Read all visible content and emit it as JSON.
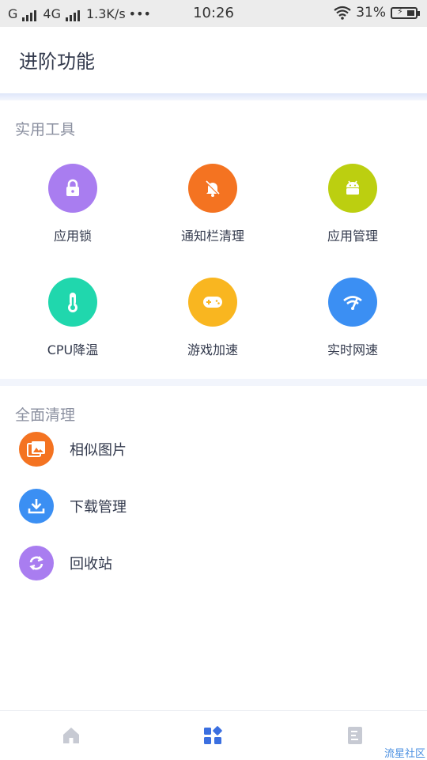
{
  "status_bar": {
    "carrier1": "G",
    "carrier2": "4G",
    "speed": "1.3K/s",
    "dots": "•••",
    "time": "10:26",
    "battery": "31%"
  },
  "header": {
    "title": "进阶功能"
  },
  "tools": {
    "title": "实用工具",
    "items": [
      {
        "label": "应用锁",
        "color": "#a97df0",
        "icon": "lock-icon"
      },
      {
        "label": "通知栏清理",
        "color": "#f47321",
        "icon": "bell-off-icon"
      },
      {
        "label": "应用管理",
        "color": "#bccf10",
        "icon": "android-icon"
      },
      {
        "label": "CPU降温",
        "color": "#20d7ad",
        "icon": "thermometer-icon"
      },
      {
        "label": "游戏加速",
        "color": "#f9b620",
        "icon": "gamepad-icon"
      },
      {
        "label": "实时网速",
        "color": "#3b8ff3",
        "icon": "wifi-speed-icon"
      }
    ]
  },
  "clean": {
    "title": "全面清理",
    "items": [
      {
        "label": "相似图片",
        "color": "#f47321",
        "icon": "images-icon"
      },
      {
        "label": "下载管理",
        "color": "#3b8ff3",
        "icon": "download-icon"
      },
      {
        "label": "回收站",
        "color": "#a97df0",
        "icon": "recycle-icon"
      }
    ]
  },
  "bottom_nav": {
    "items": [
      {
        "icon": "home-icon",
        "active": false
      },
      {
        "icon": "grid-icon",
        "active": true
      },
      {
        "icon": "document-icon",
        "active": false
      }
    ],
    "active_color": "#3b6fe0",
    "inactive_color": "#c7cad3"
  },
  "watermark": "流星社区"
}
